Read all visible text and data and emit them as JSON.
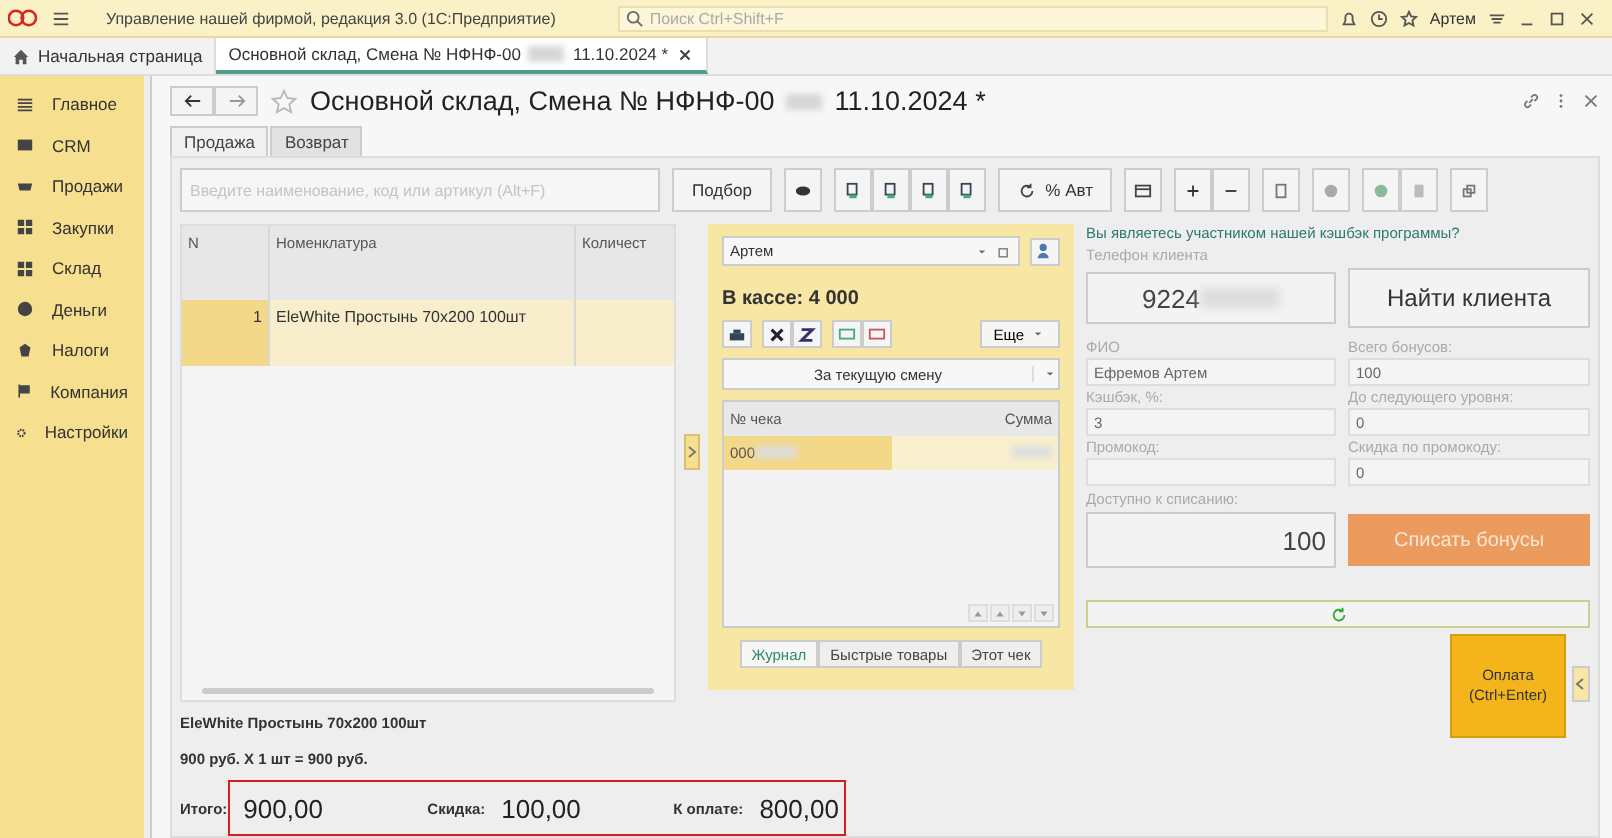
{
  "app_bar": {
    "title": "Управление нашей фирмой, редакция 3.0  (1С:Предприятие)",
    "search_placeholder": "Поиск Ctrl+Shift+F",
    "user": "Артем"
  },
  "open_tabs": [
    {
      "label": "Начальная страница",
      "selected": false,
      "kind": "home"
    },
    {
      "label": "Основной склад, Смена № НФНФ-00",
      "suffix": "11.10.2024 *",
      "selected": true,
      "kind": "doc"
    }
  ],
  "sidebar": {
    "items": [
      {
        "label": "Главное"
      },
      {
        "label": "CRM"
      },
      {
        "label": "Продажи"
      },
      {
        "label": "Закупки"
      },
      {
        "label": "Склад"
      },
      {
        "label": "Деньги"
      },
      {
        "label": "Налоги"
      },
      {
        "label": "Компания"
      },
      {
        "label": "Настройки"
      }
    ]
  },
  "document": {
    "title": "Основной склад, Смена № НФНФ-00",
    "title_date": "11.10.2024 *",
    "tabs": [
      {
        "label": "Продажа",
        "selected": true
      },
      {
        "label": "Возврат",
        "selected": false
      }
    ],
    "search_placeholder": "Введите наименование, код или артикул (Alt+F)",
    "pick_button": "Подбор",
    "auto_discount_button": "% Авт",
    "table": {
      "columns": [
        "N",
        "Номенклатура",
        "Количест"
      ],
      "rows": [
        {
          "n": "1",
          "name": "EleWhite Простынь 70х200 100шт",
          "selected": true
        }
      ]
    },
    "item_name": "EleWhite Простынь 70х200 100шт",
    "item_calc": "900 руб. Х 1 шт = 900 руб.",
    "totals": [
      {
        "label": "Итого:",
        "value": "900,00"
      },
      {
        "label": "Скидка:",
        "value": "100,00"
      },
      {
        "label": "К оплате:",
        "value": "800,00"
      }
    ],
    "pay_button": {
      "label": "Оплата",
      "shortcut": "(Ctrl+Enter)"
    }
  },
  "cash_panel": {
    "cashier": "Артем",
    "cash": "В кассе: 4 000",
    "more_button": "Еще",
    "period": "За текущую смену",
    "columns": [
      "№ чека",
      "Сумма"
    ],
    "rows": [
      {
        "number": "000",
        "selected": true
      }
    ],
    "tabs": [
      {
        "label": "Журнал",
        "selected": true
      },
      {
        "label": "Быстрые товары",
        "selected": false
      },
      {
        "label": "Этот чек",
        "selected": false
      }
    ]
  },
  "cashback": {
    "question": "Вы являетесь участником нашей кэшбэк программы?",
    "phone_label": "Телефон клиента",
    "phone": "9224",
    "find_button": "Найти клиента",
    "fields": [
      {
        "label": "ФИО",
        "value": "Ефремов Артем"
      },
      {
        "label": "Всего бонусов:",
        "value": "100"
      },
      {
        "label": "Кэшбэк, %:",
        "value": "3"
      },
      {
        "label": "До следующего уровня:",
        "value": "0"
      },
      {
        "label": "Промокод:"
      },
      {
        "label": "Скидка по промокоду:",
        "value": "0"
      }
    ],
    "available_label": "Доступно к списанию:",
    "available": "100",
    "write_off_button": "Списать бонусы"
  }
}
